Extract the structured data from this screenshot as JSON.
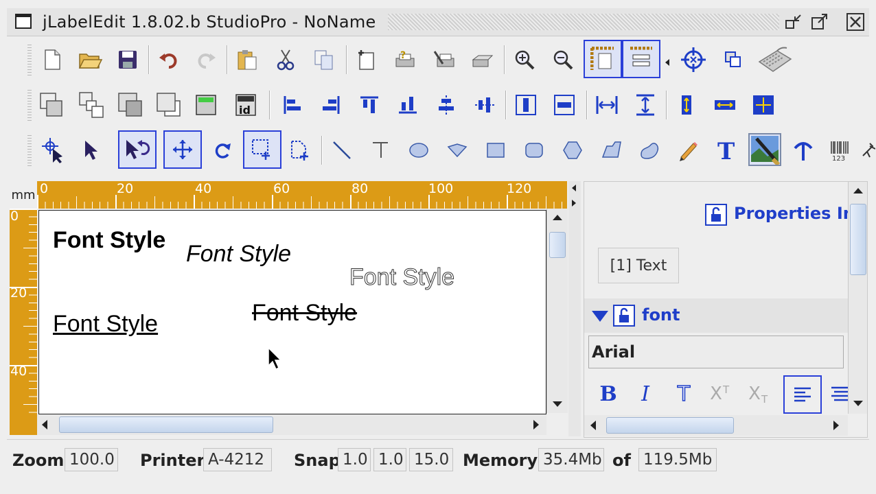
{
  "window": {
    "title": "jLabelEdit 1.8.02.b StudioPro - NoName"
  },
  "ruler": {
    "unit": "mm",
    "top_labels": [
      "0",
      "20",
      "40",
      "60",
      "80",
      "100",
      "120"
    ],
    "left_labels": [
      "0",
      "20",
      "40"
    ]
  },
  "canvas": {
    "samples": [
      {
        "text": "Font Style",
        "style": "bold"
      },
      {
        "text": "Font Style",
        "style": "italic"
      },
      {
        "text": "Font Style",
        "style": "outline"
      },
      {
        "text": "Font Style",
        "style": "underline"
      },
      {
        "text": "Font Style",
        "style": "strikethrough"
      }
    ]
  },
  "properties": {
    "title": "Properties Ins",
    "selected_tab": "[1] Text",
    "section_label": "font",
    "font_name": "Arial",
    "format_buttons": [
      "B",
      "I",
      "T",
      "X",
      "X"
    ]
  },
  "status": {
    "zoom_label": "Zoom",
    "zoom_value": "100.0",
    "printer_label": "Printer",
    "printer_value": "A-4212",
    "snap_label": "Snap",
    "snap_x": "1.0",
    "snap_y": "1.0",
    "snap_angle": "15.0",
    "memory_label": "Memory",
    "memory_used": "35.4Mb",
    "memory_of_label": "of",
    "memory_total": "119.5Mb"
  },
  "colors": {
    "accent": "#1f3ec9",
    "ruler": "#dc9b16",
    "active_border": "#2a3fd8"
  },
  "toolbar_icons": {
    "row1": [
      "new-document-icon",
      "open-folder-icon",
      "save-icon",
      "undo-icon",
      "redo-icon",
      "paste-icon",
      "cut-icon",
      "copy-icon",
      "page-setup-icon",
      "print-help-icon",
      "printer-settings-icon",
      "print-icon",
      "zoom-in-icon",
      "zoom-out-icon",
      "page-frame-icon",
      "label-layout-icon",
      "target-icon",
      "bring-front-icon",
      "keyboard-icon"
    ],
    "row2": [
      "group-icon",
      "ungroup-icon",
      "to-back-icon",
      "to-front-icon",
      "counter-icon",
      "id-field-icon",
      "align-left-icon",
      "align-right-icon",
      "align-top-icon",
      "align-bottom-icon",
      "align-center-h-icon",
      "align-center-v-icon",
      "center-h-icon",
      "center-v-icon",
      "distribute-h-icon",
      "distribute-v-icon",
      "same-height-icon",
      "same-width-icon",
      "same-size-icon"
    ],
    "row3": [
      "select-multi-icon",
      "pointer-icon",
      "pointer-undo-icon",
      "move-icon",
      "rotate-icon",
      "select-area-icon",
      "edit-points-icon",
      "line-icon",
      "angle-line-icon",
      "ellipse-icon",
      "diamond-icon",
      "rectangle-icon",
      "rounded-rect-icon",
      "polygon-icon",
      "parallelogram-icon",
      "blob-icon",
      "pencil-icon",
      "text-icon",
      "image-icon",
      "arc-text-icon",
      "barcode-icon",
      "run-icon"
    ]
  }
}
